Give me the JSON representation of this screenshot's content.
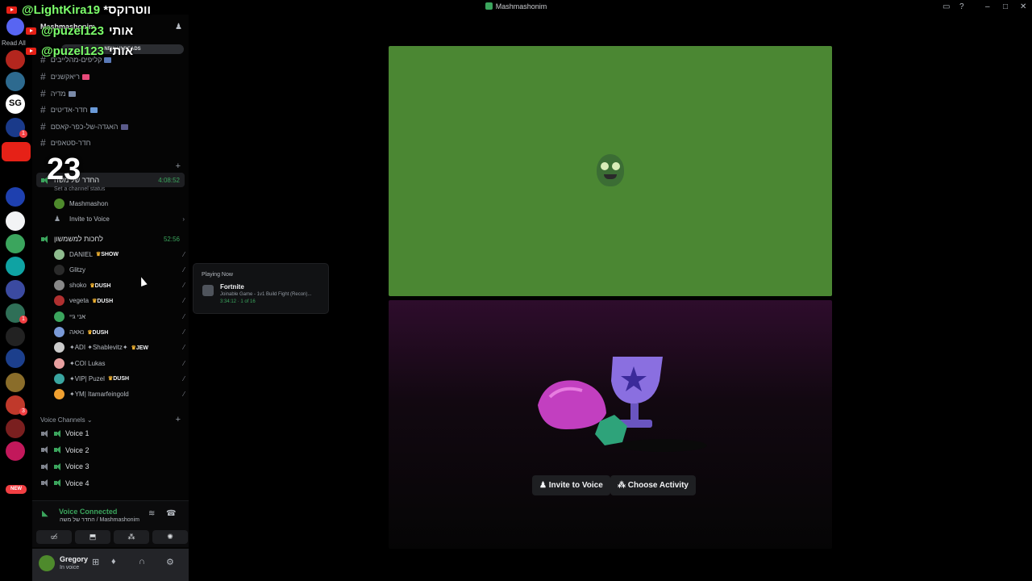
{
  "window": {
    "title": "Mashmashonim"
  },
  "overlay": {
    "top_name": "@LightKira19",
    "top_text": "*ווטרוקס",
    "names": [
      {
        "name": "@puzel123",
        "text": "אותי"
      },
      {
        "name": "@puzel123",
        "text": "אותי"
      }
    ],
    "big_number": "23"
  },
  "rail": {
    "read_all": "Read All",
    "new_label": "NEW",
    "servers": [
      {
        "color": "#b3261e",
        "badge": ""
      },
      {
        "color": "#2d6a8f",
        "badge": ""
      },
      {
        "color": "#ffffff",
        "badge": "",
        "label": "SG"
      },
      {
        "color": "#1a3a8a",
        "badge": "1"
      },
      {
        "color": "#e62117",
        "badge": "",
        "youtube": true
      },
      {
        "color": "#1e40af",
        "badge": ""
      },
      {
        "color": "#f2f3f5",
        "badge": ""
      },
      {
        "color": "#3ba55d",
        "badge": ""
      },
      {
        "color": "#0fa3a3",
        "badge": ""
      },
      {
        "color": "#3b4aa0",
        "badge": ""
      },
      {
        "color": "#2f6f57",
        "badge": "1"
      },
      {
        "color": "#222222",
        "badge": ""
      },
      {
        "color": "#1c3f8c",
        "badge": ""
      },
      {
        "color": "#8a6d2a",
        "badge": ""
      },
      {
        "color": "#c0392b",
        "badge": "3"
      },
      {
        "color": "#7a1f1f",
        "badge": ""
      },
      {
        "color": "#c2185b",
        "badge": ""
      }
    ]
  },
  "sidebar": {
    "server_name": "Mashmashonim",
    "new_unreads": "NEW UNREADS",
    "channels": [
      {
        "name": "קליפים-מהלייבים",
        "emo_color": "#5a7ab8"
      },
      {
        "name": "ריאקשנים",
        "emo_color": "#e84a7a"
      },
      {
        "name": "מדיה",
        "emo_color": "#7a8aa8"
      },
      {
        "name": "חדר-אדיטים",
        "emo_color": "#6a9ad8"
      },
      {
        "name": "האגדה-של-כפר-קאסם",
        "emo_color": "#5a5a8a"
      },
      {
        "name": "חדר-סטאפים",
        "emo_color": ""
      }
    ],
    "active_voice": {
      "name": "החדר של משה",
      "time": "4:08:52",
      "status": "Set a channel status",
      "member": "Mashmashon",
      "invite": "Invite to Voice"
    },
    "second_voice": {
      "name": "לחכות למשמשון",
      "time": "52:56",
      "members": [
        {
          "name": "DANIEL",
          "tag": "SHOW",
          "color": "#8fbc8f"
        },
        {
          "name": "Glitzy",
          "tag": "",
          "color": "#2a2a2a"
        },
        {
          "name": "shoko",
          "tag": "DUSH",
          "color": "#888888"
        },
        {
          "name": "vegeta",
          "tag": "DUSH",
          "color": "#b03030"
        },
        {
          "name": "אני גיי",
          "tag": "",
          "color": "#3ba55d"
        },
        {
          "name": "נאאה",
          "tag": "DUSH",
          "color": "#7a9ad8"
        },
        {
          "name": "✦ADI ✦Shablevitz✦",
          "tag": "JEW",
          "color": "#cccccc"
        },
        {
          "name": "✦COI Lukas",
          "tag": "",
          "color": "#e8a0a0"
        },
        {
          "name": "✦VIP| Puzel",
          "tag": "DUSH",
          "color": "#3aa5a0"
        },
        {
          "name": "✦YM| Itamarfeingold",
          "tag": "",
          "color": "#f0a030"
        }
      ]
    },
    "voice_channels_header": "Voice Channels",
    "voice_channels": [
      "Voice 1",
      "Voice 2",
      "Voice 3",
      "Voice 4"
    ]
  },
  "voice_panel": {
    "status": "Voice Connected",
    "location": "החדר של משה / Mashmashonim"
  },
  "user_panel": {
    "name": "Gregory",
    "status": "In voice"
  },
  "activity_popup": {
    "header": "Playing Now",
    "game": "Fortnite",
    "details": "Joinable Game - 1v1 Build Fight (Recon)...",
    "time": "3:34:12",
    "party": "1 of 16"
  },
  "stage": {
    "invite_label": "Invite to Voice",
    "choose_activity_label": "Choose Activity"
  }
}
